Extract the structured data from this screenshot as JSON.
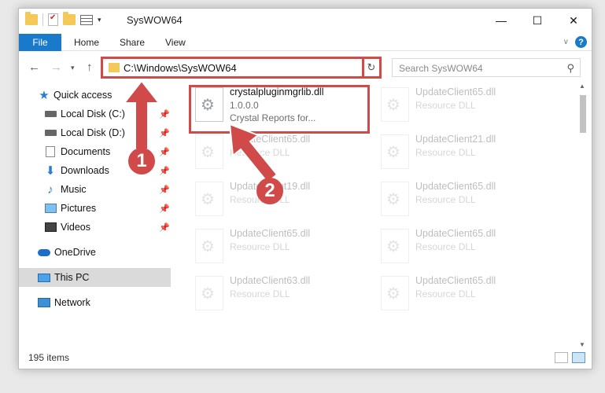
{
  "window": {
    "title": "SysWOW64"
  },
  "ribbon": {
    "file_label": "File",
    "tabs": [
      "Home",
      "Share",
      "View"
    ]
  },
  "nav": {
    "address": "C:\\Windows\\SysWOW64",
    "search_placeholder": "Search SysWOW64"
  },
  "sidebar": {
    "items": [
      {
        "label": "Quick access",
        "icon": "star-icon",
        "pinned": false
      },
      {
        "label": "Local Disk (C:)",
        "icon": "drive-icon",
        "pinned": true
      },
      {
        "label": "Local Disk (D:)",
        "icon": "drive-icon",
        "pinned": true
      },
      {
        "label": "Documents",
        "icon": "documents-icon",
        "pinned": true
      },
      {
        "label": "Downloads",
        "icon": "download-icon",
        "pinned": true
      },
      {
        "label": "Music",
        "icon": "music-icon",
        "pinned": true
      },
      {
        "label": "Pictures",
        "icon": "pictures-icon",
        "pinned": true
      },
      {
        "label": "Videos",
        "icon": "videos-icon",
        "pinned": true
      },
      {
        "label": "OneDrive",
        "icon": "cloud-icon",
        "pinned": false
      },
      {
        "label": "This PC",
        "icon": "computer-icon",
        "pinned": false
      },
      {
        "label": "Network",
        "icon": "network-icon",
        "pinned": false
      }
    ]
  },
  "files": [
    {
      "name": "crystalpluginmgrlib.dll",
      "line2": "1.0.0.0",
      "line3": "Crystal Reports for...",
      "highlight": true
    },
    {
      "name": "UpdateClient65.dll",
      "line2": "Resource DLL",
      "line3": ""
    },
    {
      "name": "UpdateClient65.dll",
      "line2": "Resource DLL",
      "line3": ""
    },
    {
      "name": "UpdateClient21.dll",
      "line2": "Resource DLL",
      "line3": ""
    },
    {
      "name": "UpdateClient19.dll",
      "line2": "Resource DLL",
      "line3": ""
    },
    {
      "name": "UpdateClient65.dll",
      "line2": "Resource DLL",
      "line3": ""
    },
    {
      "name": "UpdateClient65.dll",
      "line2": "Resource DLL",
      "line3": ""
    },
    {
      "name": "UpdateClient65.dll",
      "line2": "Resource DLL",
      "line3": ""
    },
    {
      "name": "UpdateClient63.dll",
      "line2": "Resource DLL",
      "line3": ""
    },
    {
      "name": "UpdateClient65.dll",
      "line2": "Resource DLL",
      "line3": ""
    }
  ],
  "status": {
    "item_count": "195 items"
  },
  "annotations": {
    "step1": "1",
    "step2": "2",
    "color": "#d14a4a"
  }
}
